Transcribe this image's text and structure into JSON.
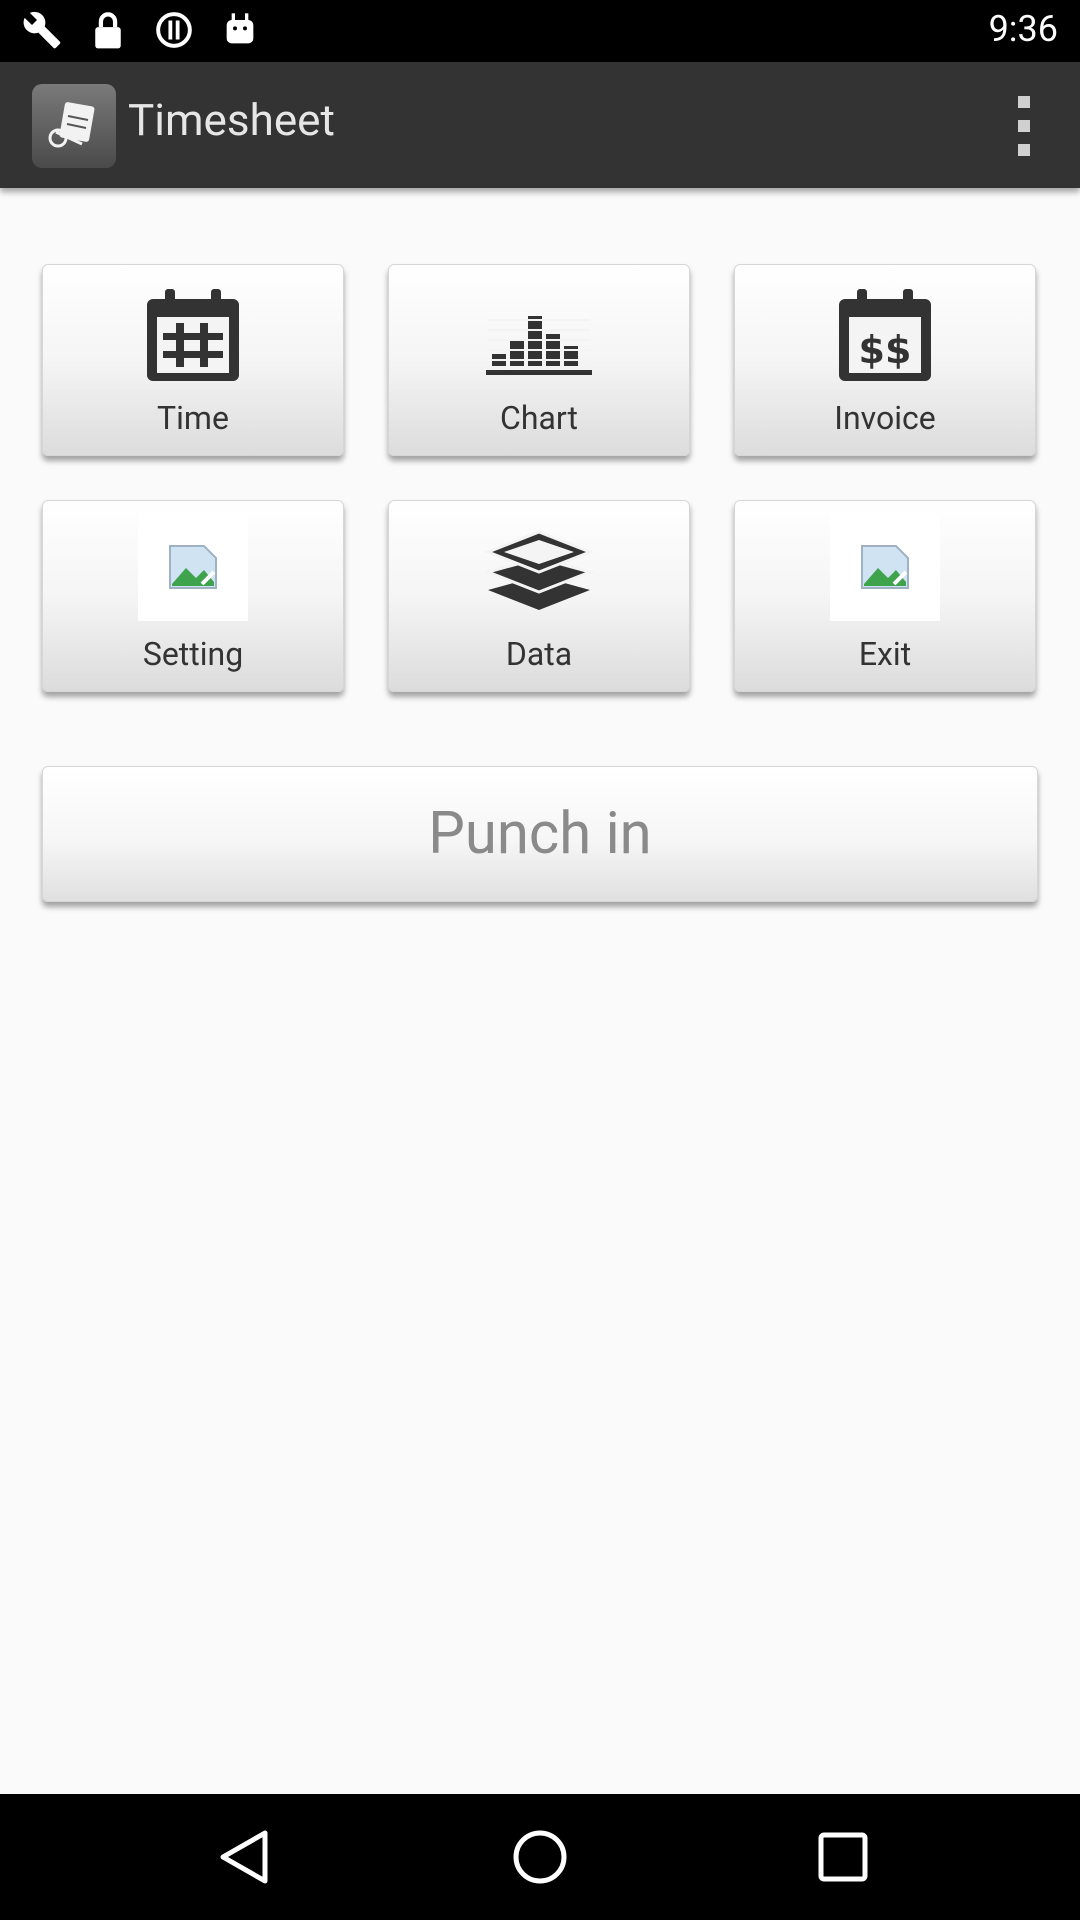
{
  "status_bar": {
    "time": "9:36",
    "icons_left": [
      "wrench-icon",
      "lock-icon",
      "alert-icon",
      "android-icon"
    ]
  },
  "app_bar": {
    "title": "Timesheet",
    "app_icon": "timesheet-app-icon",
    "menu_icon": "overflow-menu-icon"
  },
  "tiles": [
    {
      "label": "Time",
      "icon": "calendar-grid-icon"
    },
    {
      "label": "Chart",
      "icon": "bar-chart-icon"
    },
    {
      "label": "Invoice",
      "icon": "calendar-dollar-icon"
    },
    {
      "label": "Setting",
      "icon": "broken-image-icon"
    },
    {
      "label": "Data",
      "icon": "layers-icon"
    },
    {
      "label": "Exit",
      "icon": "broken-image-icon"
    }
  ],
  "punch_button": {
    "label": "Punch in"
  },
  "nav": [
    "back-icon",
    "home-icon",
    "recents-icon"
  ],
  "colors": {
    "app_bar": "#333333",
    "background": "#fafafa",
    "text": "#333333"
  }
}
